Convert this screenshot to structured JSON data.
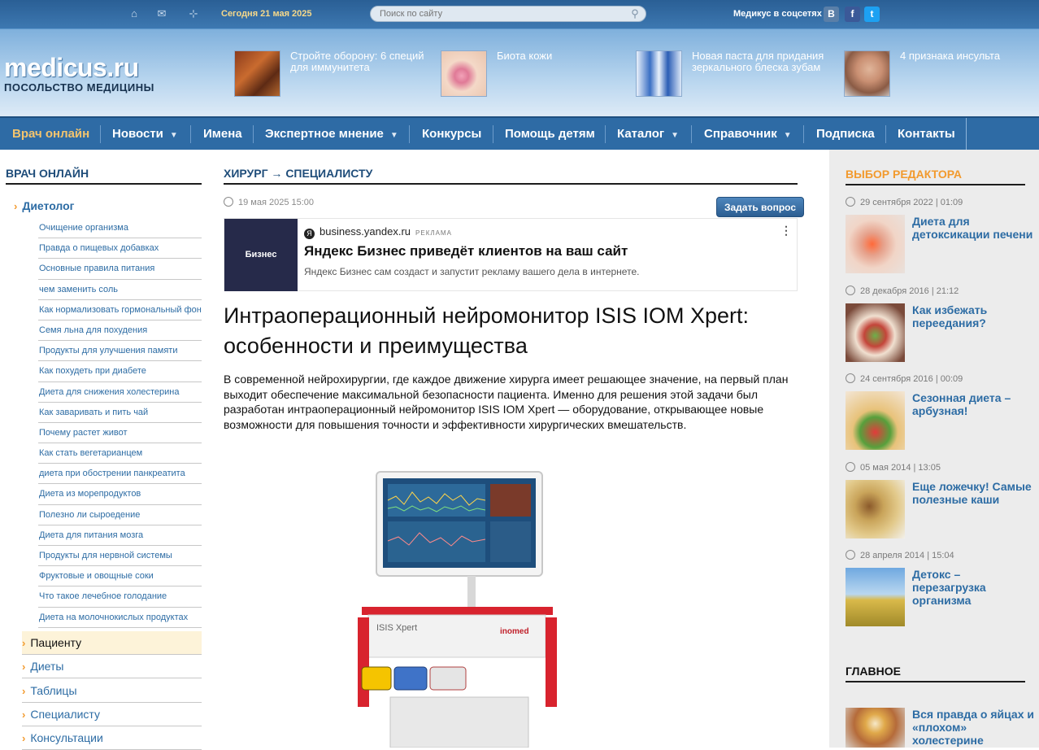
{
  "topbar": {
    "date": "Сегодня 21 мая 2025",
    "search_placeholder": "Поиск по сайту",
    "social_label": "Медикус в соцсетях",
    "social": [
      "В",
      "f",
      "t"
    ]
  },
  "logo": {
    "main": "medicus.ru",
    "sub": "ПОСОЛЬСТВО МЕДИЦИНЫ"
  },
  "teasers": [
    {
      "title": "Стройте оборону: 6 специй для иммунитета"
    },
    {
      "title": "Биота кожи"
    },
    {
      "title": "Новая паста для придания зеркального блеска зубам"
    },
    {
      "title": "4 признака инсульта"
    }
  ],
  "nav": [
    {
      "label": "Врач онлайн"
    },
    {
      "label": "Новости"
    },
    {
      "label": "Имена"
    },
    {
      "label": "Экспертное мнение"
    },
    {
      "label": "Конкурсы"
    },
    {
      "label": "Помощь детям"
    },
    {
      "label": "Каталог"
    },
    {
      "label": "Справочник"
    },
    {
      "label": "Подписка"
    },
    {
      "label": "Контакты"
    }
  ],
  "left": {
    "title": "ВРАЧ ОНЛАЙН",
    "category": "Диетолог",
    "items": [
      "Очищение организма",
      "Правда о пищевых добавках",
      "Основные правила питания",
      "чем заменить соль",
      "Как нормализовать гормональный фон",
      "Семя льна для похудения",
      "Продукты для улучшения памяти",
      "Как похудеть при диабете",
      "Диета для снижения холестерина",
      "Как заваривать и пить чай",
      "Почему растет живот",
      "Как стать вегетарианцем",
      "диета при обострении панкреатита",
      "Диета из морепродуктов",
      "Полезно ли сыроедение",
      "Диета для питания мозга",
      "Продукты для нервной системы",
      "Фруктовые и овощные соки",
      "Что такое лечебное голодание",
      "Диета на молочнокислых продуктах"
    ],
    "subcats": [
      "Пациенту",
      "Диеты",
      "Таблицы",
      "Специалисту",
      "Консультации"
    ]
  },
  "article": {
    "breadcrumb": "ХИРУРГ → СПЕЦИАЛИСТУ",
    "date": "19 мая 2025 15:00",
    "ask_button": "Задать вопрос",
    "ad": {
      "logo": "Бизнес",
      "source": "business.yandex.ru",
      "tag": "РЕКЛАМА",
      "title": "Яндекс Бизнес приведёт клиентов на ваш сайт",
      "text": "Яндекс Бизнес сам создаст и запустит рекламу вашего дела в интернете."
    },
    "title": "Интраоперационный нейромонитор ISIS IOM Xpert: особенности и преимущества",
    "lead": "В современной нейрохирургии, где каждое движение хирурга имеет решающее значение, на первый план выходит обеспечение максимальной безопасности пациента. Именно для решения этой задачи был разработан интраоперационный нейромонитор ISIS IOM Xpert — оборудование, открывающее новые возможности для повышения точности и эффективности хирургических вмешательств.",
    "device_brand": "ISIS Xpert",
    "device_maker": "inomed"
  },
  "right": {
    "title": "ВЫБОР РЕДАКТОРА",
    "items": [
      {
        "date": "29 сентября 2022  |  01:09",
        "title": "Диета для детоксикации печени"
      },
      {
        "date": "28 декабря 2016  |  21:12",
        "title": "Как избежать переедания?"
      },
      {
        "date": "24 сентября 2016  |  00:09",
        "title": "Сезонная диета – арбузная!"
      },
      {
        "date": "05 мая 2014  |  13:05",
        "title": "Еще ложечку! Самые полезные каши"
      },
      {
        "date": "28 апреля 2014  |  15:04",
        "title": "Детокс – перезагрузка организма"
      }
    ],
    "main_title": "ГЛАВНОЕ",
    "main_item": "Вся правда о яйцах и «плохом» холестерине"
  }
}
